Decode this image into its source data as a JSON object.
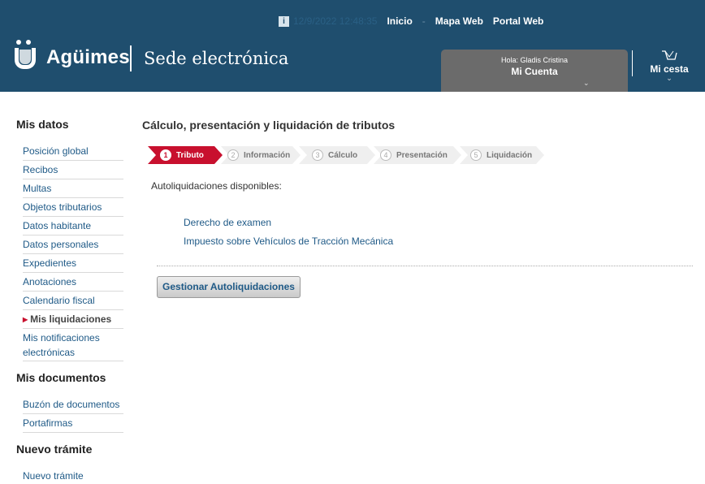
{
  "header": {
    "datetime": "12/9/2022 12:48:35",
    "top_links": [
      "Inicio",
      "Mapa Web",
      "Portal Web"
    ],
    "brand": "Agüimes",
    "site_title": "Sede electrónica",
    "account": {
      "greeting": "Hola:  Gladis Cristina",
      "label": "Mi Cuenta"
    },
    "cart_label": "Mi cesta",
    "colors": {
      "header_bg": "#1f4e6e",
      "account_bg": "#6b6b6b",
      "accent": "#c8102e"
    }
  },
  "sidebar": {
    "sections": [
      {
        "title": "Mis datos",
        "items": [
          "Posición global",
          "Recibos",
          "Multas",
          "Objetos tributarios",
          "Datos habitante",
          "Datos personales",
          "Expedientes",
          "Anotaciones",
          "Calendario fiscal",
          "Mis liquidaciones",
          "Mis notificaciones electrónicas"
        ]
      },
      {
        "title": "Mis documentos",
        "items": [
          "Buzón de documentos",
          "Portafirmas"
        ]
      },
      {
        "title": "Nuevo trámite",
        "items": [
          "Nuevo trámite"
        ]
      }
    ]
  },
  "main": {
    "title": "Cálculo, presentación y liquidación de tributos",
    "steps": [
      {
        "num": "1",
        "label": "Tributo",
        "active": true
      },
      {
        "num": "2",
        "label": "Información",
        "active": false
      },
      {
        "num": "3",
        "label": "Cálculo",
        "active": false
      },
      {
        "num": "4",
        "label": "Presentación",
        "active": false
      },
      {
        "num": "5",
        "label": "Liquidación",
        "active": false
      }
    ],
    "available_label": "Autoliquidaciones disponibles:",
    "tax_links": [
      "Derecho de examen",
      "Impuesto sobre Vehículos de Tracción Mecánica"
    ],
    "manage_button": "Gestionar Autoliquidaciones"
  }
}
